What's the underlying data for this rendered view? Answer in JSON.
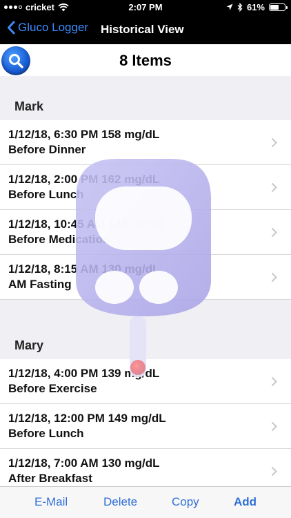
{
  "status_bar": {
    "carrier": "cricket",
    "time": "2:07 PM",
    "battery": "61%",
    "battery_level": 0.61,
    "icons": [
      "wifi-icon",
      "location-arrow-icon",
      "bluetooth-icon",
      "battery-icon"
    ]
  },
  "nav": {
    "back_label": "Gluco Logger",
    "title": "Historical View"
  },
  "search": {
    "icon": "search-icon",
    "count_label": "8 Items"
  },
  "sections": [
    {
      "name": "Mark",
      "entries": [
        {
          "reading": "1/12/18, 6:30 PM 158 mg/dL",
          "context": "Before Dinner"
        },
        {
          "reading": "1/12/18, 2:00 PM 162 mg/dL",
          "context": "Before Lunch"
        },
        {
          "reading": "1/12/18, 10:45 AM 148 mg/dL",
          "context": "Before Medication"
        },
        {
          "reading": "1/12/18, 8:15 AM 130 mg/dL",
          "context": "AM Fasting"
        }
      ]
    },
    {
      "name": "Mary",
      "entries": [
        {
          "reading": "1/12/18, 4:00 PM 139 mg/dL",
          "context": "Before Exercise"
        },
        {
          "reading": "1/12/18, 12:00 PM 149 mg/dL",
          "context": "Before Lunch"
        },
        {
          "reading": "1/12/18, 7:00 AM 130 mg/dL",
          "context": "After Breakfast"
        }
      ]
    }
  ],
  "toolbar": {
    "email_label": "E-Mail",
    "delete_label": "Delete",
    "copy_label": "Copy",
    "add_label": "Add"
  },
  "colors": {
    "accent": "#2f6fd6",
    "back_link": "#3d8bff",
    "nav_background": "#000000",
    "list_background": "#efeff4",
    "watermark": "#b9b4ee"
  }
}
